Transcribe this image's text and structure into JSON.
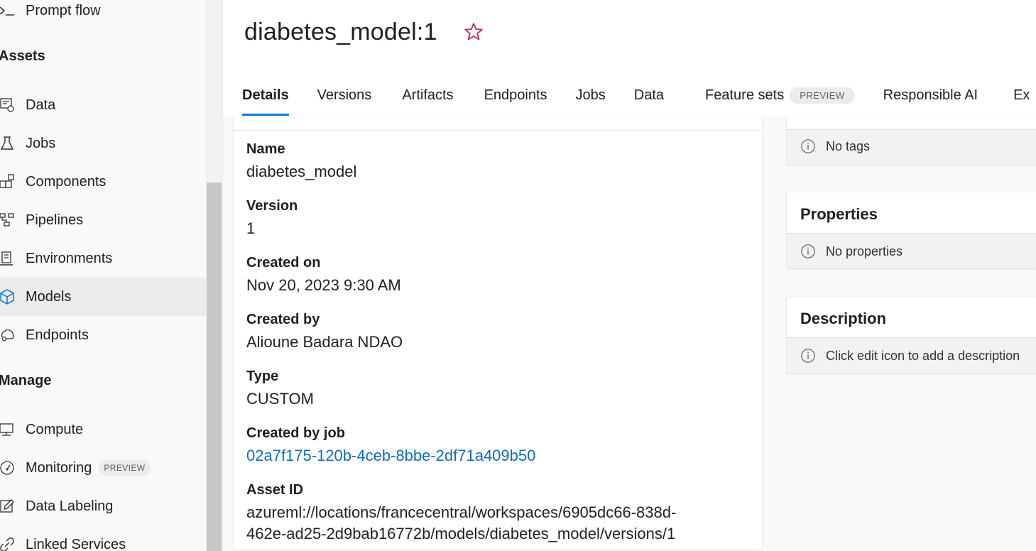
{
  "sidebar": {
    "top_item": "Prompt flow",
    "assets_heading": "Assets",
    "assets_items": [
      {
        "label": "Data",
        "icon": "data-icon"
      },
      {
        "label": "Jobs",
        "icon": "flask-icon"
      },
      {
        "label": "Components",
        "icon": "components-icon"
      },
      {
        "label": "Pipelines",
        "icon": "pipeline-icon"
      },
      {
        "label": "Environments",
        "icon": "environment-icon"
      },
      {
        "label": "Models",
        "icon": "cube-icon",
        "selected": true
      },
      {
        "label": "Endpoints",
        "icon": "endpoint-icon"
      }
    ],
    "manage_heading": "Manage",
    "manage_items": [
      {
        "label": "Compute",
        "icon": "monitor-icon"
      },
      {
        "label": "Monitoring",
        "icon": "gauge-icon",
        "badge": "PREVIEW"
      },
      {
        "label": "Data Labeling",
        "icon": "edit-icon"
      },
      {
        "label": "Linked Services",
        "icon": "link-icon"
      }
    ]
  },
  "header": {
    "title": "diabetes_model:1",
    "favorite_icon": "star-outline-icon"
  },
  "tabs": [
    {
      "label": "Details",
      "active": true
    },
    {
      "label": "Versions"
    },
    {
      "label": "Artifacts"
    },
    {
      "label": "Endpoints"
    },
    {
      "label": "Jobs"
    },
    {
      "label": "Data"
    },
    {
      "label": "Feature sets",
      "badge": "PREVIEW"
    },
    {
      "label": "Responsible AI"
    },
    {
      "label": "Ex"
    }
  ],
  "details": {
    "name_label": "Name",
    "name_value": "diabetes_model",
    "version_label": "Version",
    "version_value": "1",
    "created_on_label": "Created on",
    "created_on_value": "Nov 20, 2023 9:30 AM",
    "created_by_label": "Created by",
    "created_by_value": "Alioune Badara NDAO",
    "type_label": "Type",
    "type_value": "CUSTOM",
    "job_label": "Created by job",
    "job_value": "02a7f175-120b-4ceb-8bbe-2df71a409b50",
    "asset_id_label": "Asset ID",
    "asset_id_line1": "azureml://locations/francecentral/workspaces/6905dc66-838d-",
    "asset_id_line2": "462e-ad25-2d9bab16772b/models/diabetes_model/versions/1"
  },
  "panels": {
    "tags_info": "No tags",
    "properties_title": "Properties",
    "properties_info": "No properties",
    "description_title": "Description",
    "description_info": "Click edit icon to add a description"
  },
  "colors": {
    "accent": "#0078d4",
    "link": "#0f6cbd",
    "star": "#c4314b"
  }
}
